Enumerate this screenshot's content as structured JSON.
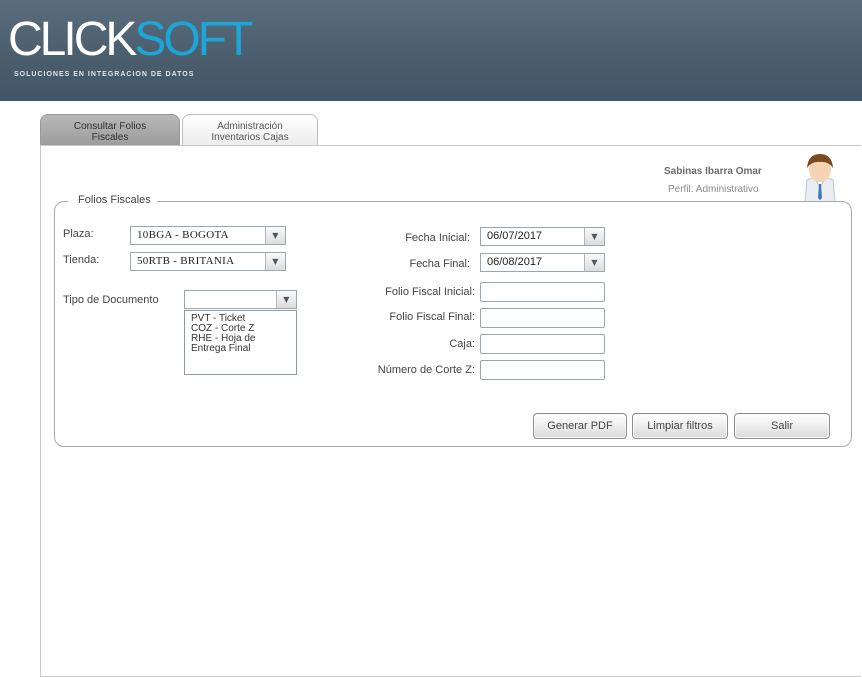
{
  "brand": {
    "logo_part1": "CLICK",
    "logo_part2": "SOFT",
    "tagline": "SOLUCIONES EN INTEGRACION DE DATOS",
    "accent_color": "#1ca6d8"
  },
  "tabs": [
    {
      "label_line1": "Consultar Folios",
      "label_line2": "Fiscales",
      "active": true
    },
    {
      "label_line1": "Administración",
      "label_line2": "Inventarios Cajas",
      "active": false
    }
  ],
  "user": {
    "name": "Sabinas Ibarra Omar",
    "role": "Perfil: Administrativo",
    "avatar_icon": "user-avatar-icon"
  },
  "form": {
    "legend": "Folios Fiscales",
    "plaza_label": "Plaza:",
    "plaza_value": "10BGA - BOGOTA",
    "tienda_label": "Tienda:",
    "tienda_value": "50RTB - BRITANIA",
    "tipo_documento_label": "Tipo de Documento",
    "tipo_documento_value": "",
    "tipo_documento_options": [
      "PVT - Ticket",
      "COZ - Corte Z",
      "RHE - Hoja de",
      "Entrega Final"
    ],
    "fecha_inicial_label": "Fecha Inicial:",
    "fecha_inicial_value": "06/07/2017",
    "fecha_final_label": "Fecha Final:",
    "fecha_final_value": "06/08/2017",
    "folio_fiscal_inicial_label": "Folio Fiscal Inicial:",
    "folio_fiscal_final_label": "Folio Fiscal Final:",
    "caja_label": "Caja:",
    "numero_corte_z_label": "Número de Corte Z:"
  },
  "buttons": {
    "generar_pdf": "Generar PDF",
    "limpiar_filtros": "Limpiar filtros",
    "salir": "Salir"
  },
  "icons": {
    "dropdown": "chevron-down-icon"
  }
}
